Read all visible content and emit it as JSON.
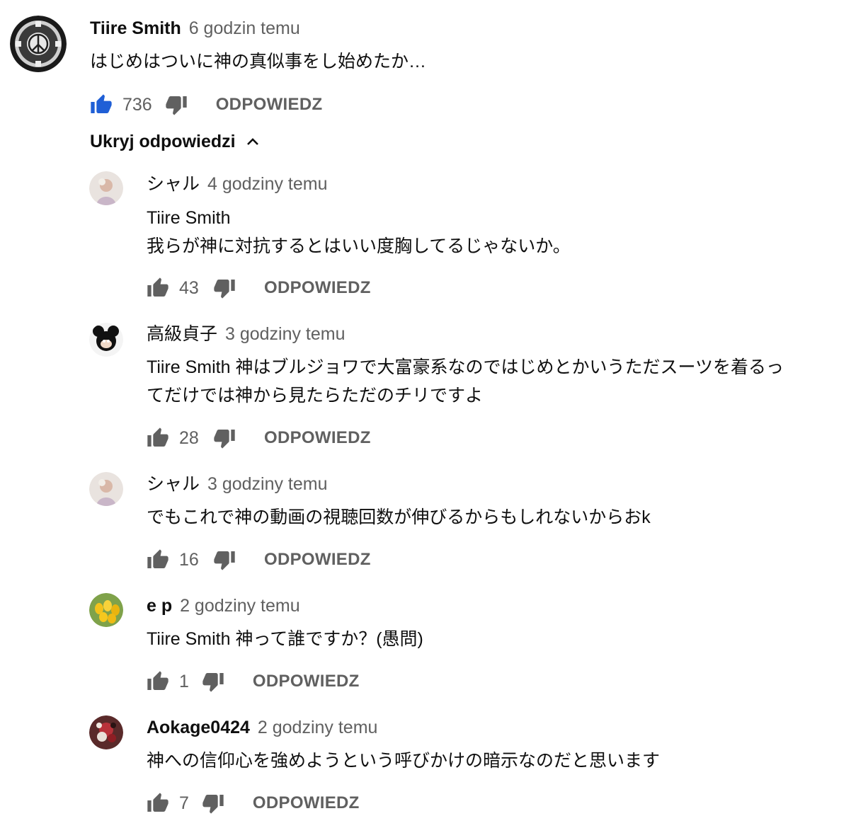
{
  "top_comment": {
    "author": "Tiire Smith",
    "time": "6 godzin temu",
    "text": "はじめはついに神の真似事をし始めたか…",
    "likes": "736",
    "reply_label": "ODPOWIEDZ",
    "liked": true
  },
  "toggle_replies_label": "Ukryj odpowiedzi",
  "replies": [
    {
      "author": "シャル",
      "time": "4 godziny temu",
      "lines": [
        "Tiire Smith",
        "我らが神に対抗するとはいい度胸してるじゃないか。"
      ],
      "likes": "43",
      "reply_label": "ODPOWIEDZ"
    },
    {
      "author": "高級貞子",
      "time": "3 godziny temu",
      "lines": [
        "Tiire Smith 神はブルジョワで大富豪系なのではじめとかいうただスーツを着るっ",
        "てだけでは神から見たらただのチリですよ"
      ],
      "likes": "28",
      "reply_label": "ODPOWIEDZ"
    },
    {
      "author": "シャル",
      "time": "3 godziny temu",
      "lines": [
        "でもこれで神の動画の視聴回数が伸びるからもしれないからおk"
      ],
      "likes": "16",
      "reply_label": "ODPOWIEDZ"
    },
    {
      "author": "e p",
      "time": "2 godziny temu",
      "lines": [
        "Tiire Smith 神って誰ですか？(愚問)"
      ],
      "likes": "1",
      "reply_label": "ODPOWIEDZ"
    },
    {
      "author": "Aokage0424",
      "time": "2 godziny temu",
      "lines": [
        "神への信仰心を強めようという呼びかけの暗示なのだと思います"
      ],
      "likes": "7",
      "reply_label": "ODPOWIEDZ"
    }
  ],
  "colors": {
    "liked_thumb": "#1f5fd6",
    "icon_gray": "#606060",
    "meta_gray": "#606060",
    "text": "#0f0f0f"
  },
  "icons": [
    "thumb-up-icon",
    "thumb-down-icon",
    "chevron-up-icon",
    "avatar"
  ]
}
